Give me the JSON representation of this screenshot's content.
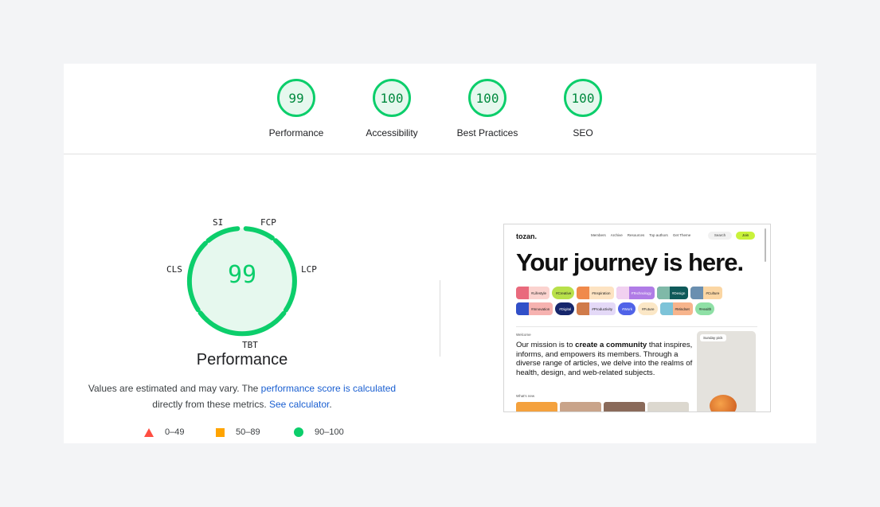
{
  "summary": {
    "gauges": [
      {
        "score": "99",
        "label": "Performance"
      },
      {
        "score": "100",
        "label": "Accessibility"
      },
      {
        "score": "100",
        "label": "Best Practices"
      },
      {
        "score": "100",
        "label": "SEO"
      }
    ]
  },
  "performance": {
    "score": "99",
    "title": "Performance",
    "metrics": {
      "si": "SI",
      "fcp": "FCP",
      "lcp": "LCP",
      "tbt": "TBT",
      "cls": "CLS"
    },
    "note_text_1": "Values are estimated and may vary. The ",
    "note_link_1": "performance score is calculated",
    "note_text_2": "directly from these metrics. ",
    "note_link_2": "See calculator",
    "note_text_3": ".",
    "legend": [
      {
        "range": "0–49",
        "color": "#ff4e42"
      },
      {
        "range": "50–89",
        "color": "#ffa400"
      },
      {
        "range": "90–100",
        "color": "#0cce6b"
      }
    ]
  },
  "screenshot": {
    "logo": "tozan.",
    "nav": [
      "Members",
      "Archive",
      "Resources",
      "Top authors",
      "Get Theme"
    ],
    "search": "Search",
    "join": "Join",
    "hero": "Your journey is here.",
    "tags_row1": [
      "#Lifestyle",
      "#Creative",
      "#Inspiration",
      "#Technology",
      "#Design",
      "#Culture"
    ],
    "tags_row2": [
      "#Innovation",
      "#Digital",
      "#Productivity",
      "#Work",
      "#Future",
      "#Mindset",
      "#Health"
    ],
    "welcome": "Welcome",
    "mission_pre": "Our mission is to ",
    "mission_bold": "create a community",
    "mission_post": " that inspires, informs, and empowers its members. Through a diverse range of articles, we delve into the realms of health, design, and web-related subjects.",
    "sunday_pick": "Sunday pick",
    "whats_new": "What's new"
  },
  "colors": {
    "pass": "#0cce6b",
    "pass_text": "#008a3e",
    "link": "#1a5fd1"
  }
}
